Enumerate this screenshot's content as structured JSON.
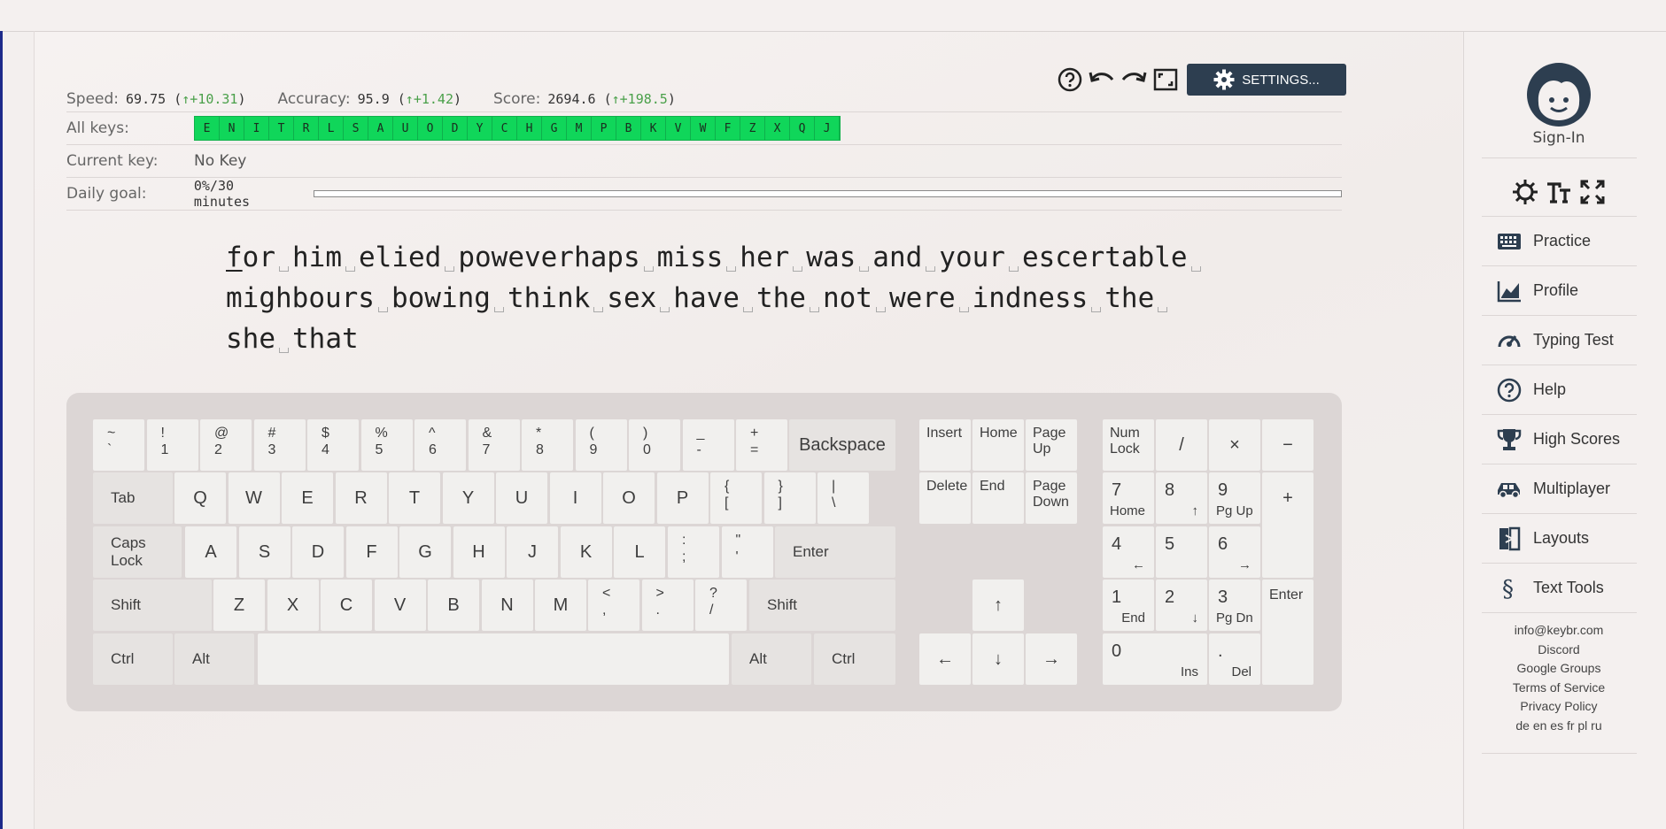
{
  "stats": {
    "speed_label": "Speed:",
    "speed_value": "69.75",
    "speed_delta": "↑+10.31",
    "accuracy_label": "Accuracy:",
    "accuracy_value": "95.9",
    "accuracy_delta": "↑+1.42",
    "score_label": "Score:",
    "score_value": "2694.6",
    "score_delta": "↑+198.5",
    "all_keys_label": "All keys:",
    "all_keys": [
      "E",
      "N",
      "I",
      "T",
      "R",
      "L",
      "S",
      "A",
      "U",
      "O",
      "D",
      "Y",
      "C",
      "H",
      "G",
      "M",
      "P",
      "B",
      "K",
      "V",
      "W",
      "F",
      "Z",
      "X",
      "Q",
      "J"
    ],
    "current_key_label": "Current key:",
    "current_key_value": "No Key",
    "daily_goal_label": "Daily goal:",
    "daily_goal_value": "0%/30 minutes",
    "daily_goal_progress": 0
  },
  "toolbar": {
    "settings_label": "SETTINGS...",
    "icons": [
      "help-icon",
      "undo-icon",
      "redo-icon",
      "fullscreen-icon",
      "gear-icon"
    ]
  },
  "lesson": {
    "lines": [
      [
        "for",
        "him",
        "elied",
        "poweverhaps",
        "miss",
        "her",
        "was",
        "and",
        "your",
        "escertable"
      ],
      [
        "mighbours",
        "bowing",
        "think",
        "sex",
        "have",
        "the",
        "not",
        "were",
        "indness",
        "the"
      ],
      [
        "she",
        "that"
      ]
    ]
  },
  "keyboard": {
    "row1": [
      [
        "~",
        "`"
      ],
      [
        "!",
        "1"
      ],
      [
        "@",
        "2"
      ],
      [
        "#",
        "3"
      ],
      [
        "$",
        "4"
      ],
      [
        "%",
        "5"
      ],
      [
        "^",
        "6"
      ],
      [
        "&",
        "7"
      ],
      [
        "*",
        "8"
      ],
      [
        "(",
        "9"
      ],
      [
        ")",
        "0"
      ],
      [
        "_",
        "-"
      ],
      [
        "+",
        "="
      ]
    ],
    "backspace": "Backspace",
    "tab": "Tab",
    "row2": [
      "Q",
      "W",
      "E",
      "R",
      "T",
      "Y",
      "U",
      "I",
      "O",
      "P"
    ],
    "row2_sym": [
      [
        "{",
        "["
      ],
      [
        "}",
        "]"
      ],
      [
        "|",
        "\\"
      ]
    ],
    "caps": "Caps Lock",
    "row3": [
      "A",
      "S",
      "D",
      "F",
      "G",
      "H",
      "J",
      "K",
      "L"
    ],
    "row3_sym": [
      [
        ":",
        ";"
      ],
      [
        "\"",
        "'"
      ]
    ],
    "enter": "Enter",
    "shift": "Shift",
    "row4": [
      "Z",
      "X",
      "C",
      "V",
      "B",
      "N",
      "M"
    ],
    "row4_sym": [
      [
        "<",
        ","
      ],
      [
        ">",
        "."
      ],
      [
        "?",
        "/"
      ]
    ],
    "ctrl": "Ctrl",
    "alt": "Alt",
    "nav": {
      "insert": "Insert",
      "home": "Home",
      "page_up": "Page\nUp",
      "delete": "Delete",
      "end": "End",
      "page_down": "Page\nDown",
      "up": "↑",
      "left": "←",
      "down": "↓",
      "right": "→"
    },
    "numpad": {
      "numlock": "Num\nLock",
      "divide": "/",
      "multiply": "×",
      "minus": "−",
      "plus": "+",
      "enter": "Enter",
      "n7": "7",
      "n7s": "Home",
      "n8": "8",
      "n8s": "↑",
      "n9": "9",
      "n9s": "Pg Up",
      "n4": "4",
      "n4s": "←",
      "n5": "5",
      "n6": "6",
      "n6s": "→",
      "n1": "1",
      "n1s": "End",
      "n2": "2",
      "n2s": "↓",
      "n3": "3",
      "n3s": "Pg Dn",
      "n0": "0",
      "n0s": "Ins",
      "dot": ".",
      "dots": "Del"
    }
  },
  "sidebar": {
    "signin": "Sign-In",
    "nav": [
      {
        "label": "Practice",
        "icon": "keyboard-icon"
      },
      {
        "label": "Profile",
        "icon": "chart-icon"
      },
      {
        "label": "Typing Test",
        "icon": "speedometer-icon"
      },
      {
        "label": "Help",
        "icon": "help-icon"
      },
      {
        "label": "High Scores",
        "icon": "trophy-icon"
      },
      {
        "label": "Multiplayer",
        "icon": "car-icon"
      },
      {
        "label": "Layouts",
        "icon": "layouts-icon"
      },
      {
        "label": "Text Tools",
        "icon": "section-icon"
      }
    ],
    "links": [
      "info@keybr.com",
      "Discord",
      "Google Groups",
      "Terms of Service",
      "Privacy Policy",
      "de en es fr pl ru"
    ]
  }
}
